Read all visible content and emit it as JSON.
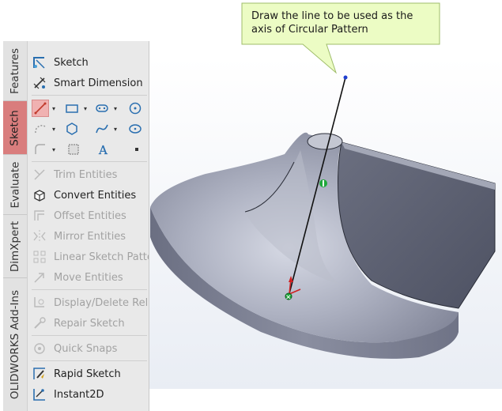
{
  "tabs": [
    {
      "label": "Features"
    },
    {
      "label": "Sketch"
    },
    {
      "label": "Evaluate"
    },
    {
      "label": "DimXpert"
    },
    {
      "label": "OLIDWORKS Add-Ins"
    }
  ],
  "commands": {
    "sketch": "Sketch",
    "smart_dimension": "Smart Dimension",
    "trim_entities": "Trim Entities",
    "convert_entities": "Convert Entities",
    "offset_entities": "Offset Entities",
    "mirror_entities": "Mirror Entities",
    "linear_sketch_pattern": "Linear Sketch Patter",
    "move_entities": "Move Entities",
    "display_delete_relations": "Display/Delete Relat",
    "repair_sketch": "Repair Sketch",
    "quick_snaps": "Quick Snaps",
    "rapid_sketch": "Rapid Sketch",
    "instant2d": "Instant2D"
  },
  "tool_icons": [
    "line-icon",
    "rectangle-icon",
    "slot-icon",
    "circle-icon",
    "polygon-icon",
    "spline-icon",
    "ellipse-icon",
    "fillet-icon",
    "plane-icon",
    "text-icon",
    "point-icon"
  ],
  "callout": {
    "text": "Draw the line to be used as the axis of Circular Pattern",
    "bg_color": "#ecfcc4",
    "border_color": "#9fbd6a"
  },
  "colors": {
    "active_tab": "#d97d7d",
    "model_face": "#8e92a4",
    "axis_line": "#111111"
  }
}
